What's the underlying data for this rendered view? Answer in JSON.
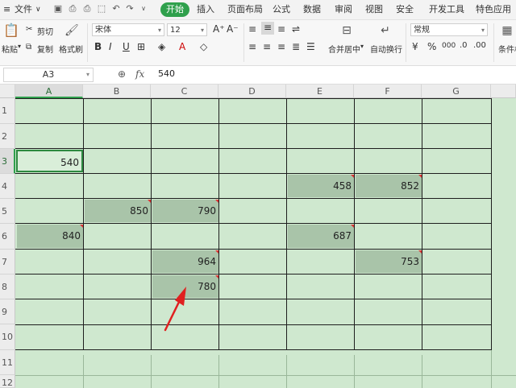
{
  "menu": {
    "file_label": "文件",
    "tabs": [
      "开始",
      "插入",
      "页面布局",
      "公式",
      "数据",
      "审阅",
      "视图",
      "安全",
      "开发工具",
      "特色应用"
    ],
    "active_tab": "开始"
  },
  "ribbon": {
    "paste_label": "粘贴",
    "cut_label": "剪切",
    "copy_label": "复制",
    "format_painter_label": "格式刷",
    "font_name": "宋体",
    "font_size": "12",
    "merge_center_label": "合并居中",
    "wrap_text_label": "自动换行",
    "number_format": "常规",
    "conditional_format_label": "条件格式",
    "bold_label": "B",
    "italic_label": "I",
    "underline_label": "U",
    "grow_font_label": "A⁺",
    "shrink_font_label": "A⁻",
    "percent_label": "%",
    "comma_label": "000"
  },
  "formula_bar": {
    "name_box": "A3",
    "fx_label": "fx",
    "value": "540"
  },
  "columns": [
    "A",
    "B",
    "C",
    "D",
    "E",
    "F",
    "G"
  ],
  "rows": [
    "1",
    "2",
    "3",
    "4",
    "5",
    "6",
    "7",
    "8",
    "9",
    "10",
    "11",
    "12"
  ],
  "selected_column": "A",
  "selected_row": "3",
  "cells": {
    "A3": "540",
    "E4": "458",
    "F4": "852",
    "B5": "850",
    "C5": "790",
    "A6": "840",
    "E6": "687",
    "C7": "964",
    "F7": "753",
    "C8": "780"
  },
  "colors": {
    "sheet_fill": "#cfe8cf",
    "cell_fill": "#a9c4a9",
    "accent": "#2fa04c",
    "arrow": "#e02020"
  }
}
